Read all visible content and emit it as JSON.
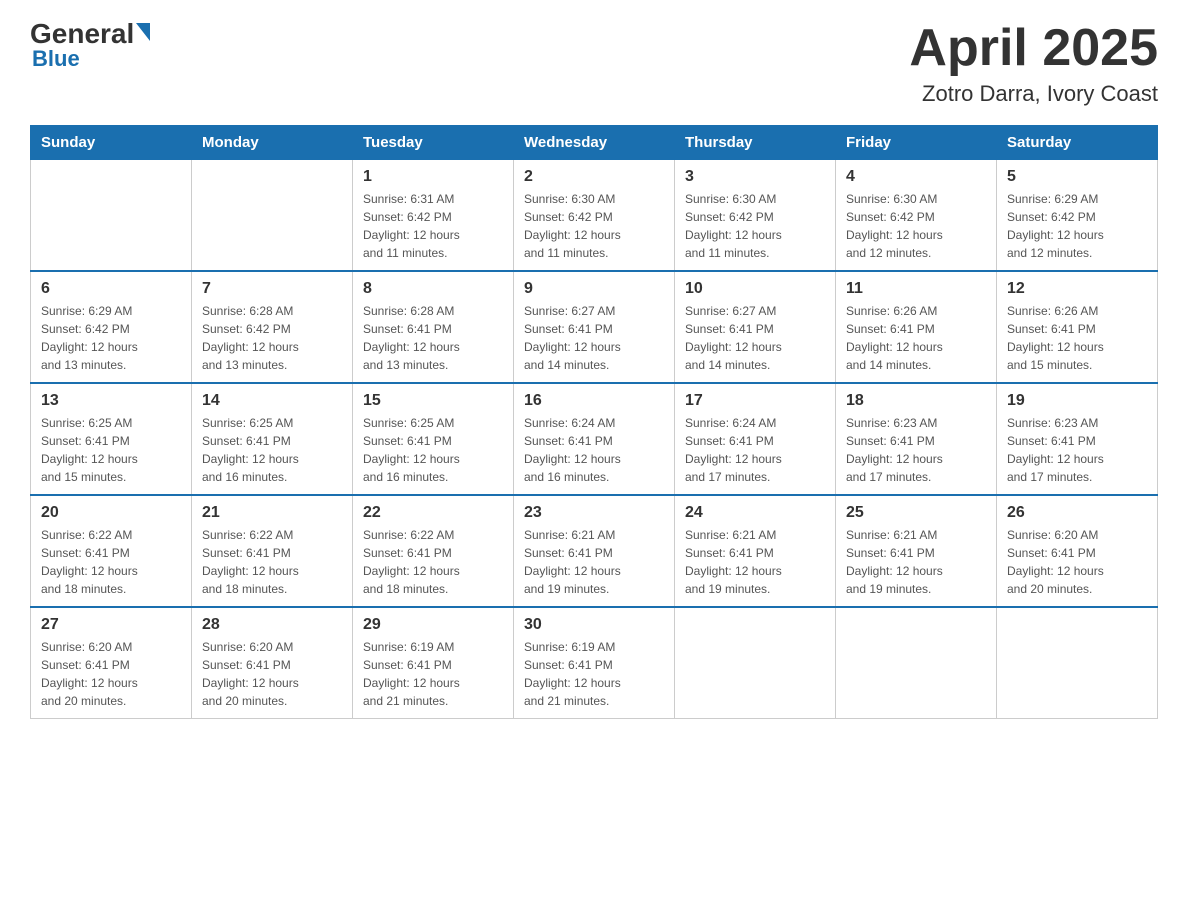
{
  "logo": {
    "general": "General",
    "blue": "Blue"
  },
  "title": {
    "month_year": "April 2025",
    "location": "Zotro Darra, Ivory Coast"
  },
  "days_of_week": [
    "Sunday",
    "Monday",
    "Tuesday",
    "Wednesday",
    "Thursday",
    "Friday",
    "Saturday"
  ],
  "weeks": [
    [
      {
        "day": "",
        "info": ""
      },
      {
        "day": "",
        "info": ""
      },
      {
        "day": "1",
        "info": "Sunrise: 6:31 AM\nSunset: 6:42 PM\nDaylight: 12 hours\nand 11 minutes."
      },
      {
        "day": "2",
        "info": "Sunrise: 6:30 AM\nSunset: 6:42 PM\nDaylight: 12 hours\nand 11 minutes."
      },
      {
        "day": "3",
        "info": "Sunrise: 6:30 AM\nSunset: 6:42 PM\nDaylight: 12 hours\nand 11 minutes."
      },
      {
        "day": "4",
        "info": "Sunrise: 6:30 AM\nSunset: 6:42 PM\nDaylight: 12 hours\nand 12 minutes."
      },
      {
        "day": "5",
        "info": "Sunrise: 6:29 AM\nSunset: 6:42 PM\nDaylight: 12 hours\nand 12 minutes."
      }
    ],
    [
      {
        "day": "6",
        "info": "Sunrise: 6:29 AM\nSunset: 6:42 PM\nDaylight: 12 hours\nand 13 minutes."
      },
      {
        "day": "7",
        "info": "Sunrise: 6:28 AM\nSunset: 6:42 PM\nDaylight: 12 hours\nand 13 minutes."
      },
      {
        "day": "8",
        "info": "Sunrise: 6:28 AM\nSunset: 6:41 PM\nDaylight: 12 hours\nand 13 minutes."
      },
      {
        "day": "9",
        "info": "Sunrise: 6:27 AM\nSunset: 6:41 PM\nDaylight: 12 hours\nand 14 minutes."
      },
      {
        "day": "10",
        "info": "Sunrise: 6:27 AM\nSunset: 6:41 PM\nDaylight: 12 hours\nand 14 minutes."
      },
      {
        "day": "11",
        "info": "Sunrise: 6:26 AM\nSunset: 6:41 PM\nDaylight: 12 hours\nand 14 minutes."
      },
      {
        "day": "12",
        "info": "Sunrise: 6:26 AM\nSunset: 6:41 PM\nDaylight: 12 hours\nand 15 minutes."
      }
    ],
    [
      {
        "day": "13",
        "info": "Sunrise: 6:25 AM\nSunset: 6:41 PM\nDaylight: 12 hours\nand 15 minutes."
      },
      {
        "day": "14",
        "info": "Sunrise: 6:25 AM\nSunset: 6:41 PM\nDaylight: 12 hours\nand 16 minutes."
      },
      {
        "day": "15",
        "info": "Sunrise: 6:25 AM\nSunset: 6:41 PM\nDaylight: 12 hours\nand 16 minutes."
      },
      {
        "day": "16",
        "info": "Sunrise: 6:24 AM\nSunset: 6:41 PM\nDaylight: 12 hours\nand 16 minutes."
      },
      {
        "day": "17",
        "info": "Sunrise: 6:24 AM\nSunset: 6:41 PM\nDaylight: 12 hours\nand 17 minutes."
      },
      {
        "day": "18",
        "info": "Sunrise: 6:23 AM\nSunset: 6:41 PM\nDaylight: 12 hours\nand 17 minutes."
      },
      {
        "day": "19",
        "info": "Sunrise: 6:23 AM\nSunset: 6:41 PM\nDaylight: 12 hours\nand 17 minutes."
      }
    ],
    [
      {
        "day": "20",
        "info": "Sunrise: 6:22 AM\nSunset: 6:41 PM\nDaylight: 12 hours\nand 18 minutes."
      },
      {
        "day": "21",
        "info": "Sunrise: 6:22 AM\nSunset: 6:41 PM\nDaylight: 12 hours\nand 18 minutes."
      },
      {
        "day": "22",
        "info": "Sunrise: 6:22 AM\nSunset: 6:41 PM\nDaylight: 12 hours\nand 18 minutes."
      },
      {
        "day": "23",
        "info": "Sunrise: 6:21 AM\nSunset: 6:41 PM\nDaylight: 12 hours\nand 19 minutes."
      },
      {
        "day": "24",
        "info": "Sunrise: 6:21 AM\nSunset: 6:41 PM\nDaylight: 12 hours\nand 19 minutes."
      },
      {
        "day": "25",
        "info": "Sunrise: 6:21 AM\nSunset: 6:41 PM\nDaylight: 12 hours\nand 19 minutes."
      },
      {
        "day": "26",
        "info": "Sunrise: 6:20 AM\nSunset: 6:41 PM\nDaylight: 12 hours\nand 20 minutes."
      }
    ],
    [
      {
        "day": "27",
        "info": "Sunrise: 6:20 AM\nSunset: 6:41 PM\nDaylight: 12 hours\nand 20 minutes."
      },
      {
        "day": "28",
        "info": "Sunrise: 6:20 AM\nSunset: 6:41 PM\nDaylight: 12 hours\nand 20 minutes."
      },
      {
        "day": "29",
        "info": "Sunrise: 6:19 AM\nSunset: 6:41 PM\nDaylight: 12 hours\nand 21 minutes."
      },
      {
        "day": "30",
        "info": "Sunrise: 6:19 AM\nSunset: 6:41 PM\nDaylight: 12 hours\nand 21 minutes."
      },
      {
        "day": "",
        "info": ""
      },
      {
        "day": "",
        "info": ""
      },
      {
        "day": "",
        "info": ""
      }
    ]
  ]
}
